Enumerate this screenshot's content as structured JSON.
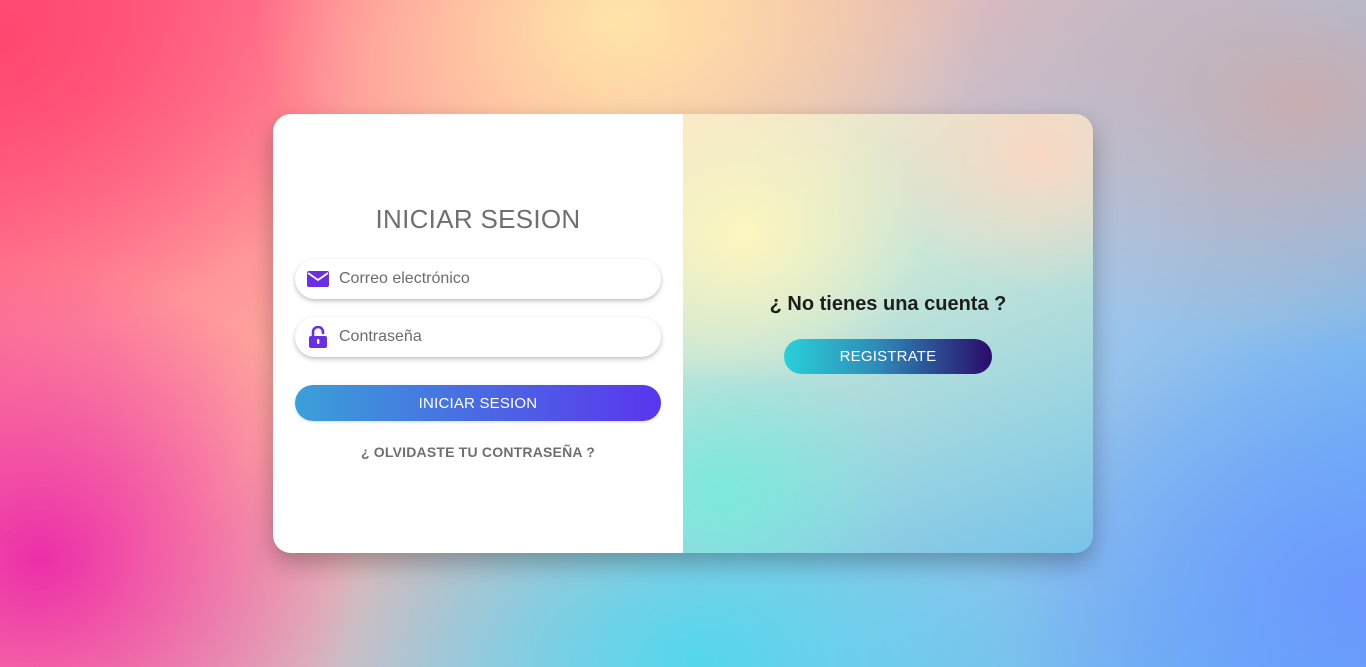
{
  "login": {
    "title": "INICIAR SESION",
    "email_placeholder": "Correo electrónico",
    "password_placeholder": "Contraseña",
    "submit_label": "INICIAR SESION",
    "forgot_label": "¿ OLVIDASTE TU CONTRASEÑA ?"
  },
  "signup": {
    "question": "¿ No tienes una cuenta ?",
    "button_label": "REGISTRATE"
  },
  "icons": {
    "email": "envelope-icon",
    "password": "unlock-icon"
  },
  "colors": {
    "icon_accent": "#6a2fe0",
    "login_button_start": "#3aa0d8",
    "login_button_end": "#5a35ee",
    "signup_button_start": "#2ad0d8",
    "signup_button_end": "#2a0c6a"
  }
}
